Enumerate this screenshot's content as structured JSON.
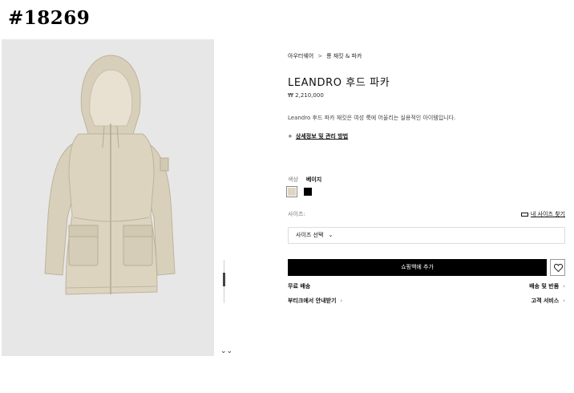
{
  "tag": "#18269",
  "breadcrumb": {
    "part1": "아우터웨어",
    "sep": ">",
    "part2": "롱 재킷 & 파카"
  },
  "product": {
    "title": "LEANDRO 후드 파카",
    "price": "₩ 2,210,000",
    "description": "Leandro 후드 파카 재킷은 여성 룩에 어울리는 실용적인 아이템입니다.",
    "details_prefix": "+",
    "details_link": "상세정보 및 관리 방법"
  },
  "color": {
    "label": "색상",
    "selected": "베이지",
    "swatches": [
      {
        "name": "beige",
        "hex": "#ddd6c3"
      },
      {
        "name": "black",
        "hex": "#000000"
      }
    ]
  },
  "size": {
    "label": "사이즈:",
    "guide_link": "내 사이즈 찾기",
    "select_value": "사이즈 선택",
    "chevron": "⌄"
  },
  "actions": {
    "add_to_bag": "쇼핑백에 추가",
    "free_shipping": "무료 배송",
    "shipping_returns": "배송 및 반품",
    "boutique_guide": "부티크에서 안내받기",
    "customer_service": "고객 서비스",
    "arrow": "›"
  },
  "gallery": {
    "scroll_icon": "double-chevron-down-icon",
    "scroll_glyph": "⌄⌄"
  },
  "colors": {
    "gallery_bg": "#e7e7e7",
    "jacket": "#ddd4c0",
    "button_bg": "#000000"
  }
}
